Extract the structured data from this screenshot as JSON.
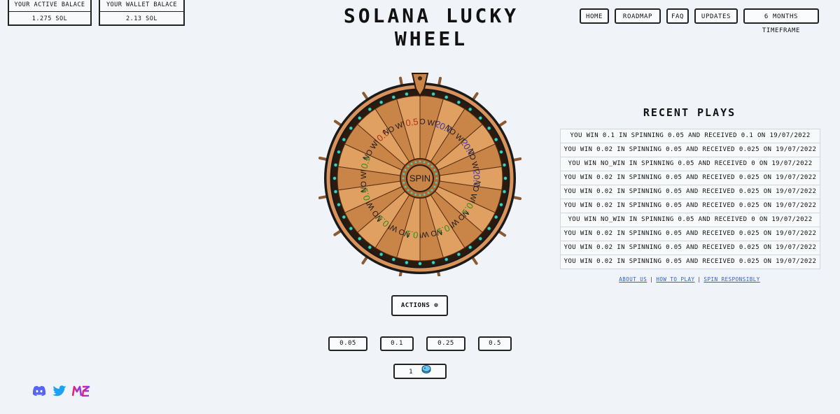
{
  "balances": {
    "active_label": "YOUR ACTIVE BALACE",
    "active_value": "1.275 SOL",
    "wallet_label": "YOUR WALLET BALACE",
    "wallet_value": "2.13 SOL"
  },
  "title": "SOLANA LUCKY WHEEL",
  "nav": [
    "HOME",
    "ROADMAP",
    "FAQ",
    "UPDATES",
    "6 MONTHS TIMEFRAME"
  ],
  "wheel": {
    "center_label": "SPIN",
    "segments": [
      "NO WIN",
      "20.0",
      "NO WIN",
      "20.0",
      "NO WIN",
      "20.0",
      "NO WIN",
      "0.1",
      "NO WIN",
      "0.1",
      "NO WIN",
      "0.1",
      "NO WIN",
      "0.1",
      "NO WIN",
      "0.1",
      "NO WIN",
      "0.1",
      "NO WIN",
      "0.5",
      "NO WIN",
      "0.5"
    ],
    "colors": {
      "wood_light": "#e0a062",
      "wood_dark": "#8a4e22",
      "rim": "#1a1a1a",
      "gem": "#3fd0c0"
    }
  },
  "recent": {
    "title": "RECENT PLAYS",
    "rows": [
      "YOU WIN 0.1 IN SPINNING 0.05 AND RECEIVED 0.1 ON 19/07/2022",
      "YOU WIN 0.02 IN SPINNING 0.05 AND RECEIVED 0.025 ON 19/07/2022",
      "YOU WIN NO_WIN IN SPINNING 0.05 AND RECEIVED 0 ON 19/07/2022",
      "YOU WIN 0.02 IN SPINNING 0.05 AND RECEIVED 0.025 ON 19/07/2022",
      "YOU WIN 0.02 IN SPINNING 0.05 AND RECEIVED 0.025 ON 19/07/2022",
      "YOU WIN 0.02 IN SPINNING 0.05 AND RECEIVED 0.025 ON 19/07/2022",
      "YOU WIN NO_WIN IN SPINNING 0.05 AND RECEIVED 0 ON 19/07/2022",
      "YOU WIN 0.02 IN SPINNING 0.05 AND RECEIVED 0.025 ON 19/07/2022",
      "YOU WIN 0.02 IN SPINNING 0.05 AND RECEIVED 0.025 ON 19/07/2022",
      "YOU WIN 0.02 IN SPINNING 0.05 AND RECEIVED 0.025 ON 19/07/2022"
    ]
  },
  "links": {
    "about": "ABOUT US",
    "how": "HOW TO PLAY",
    "responsibly": "SPIN RESPONSIBLY",
    "sep": "|"
  },
  "actions": {
    "label": "ACTIONS ⊕"
  },
  "bets": [
    "0.05",
    "0.1",
    "0.25",
    "0.5"
  ],
  "quantity": {
    "value": "1",
    "icon": "coin-icon"
  },
  "social": {
    "discord_color": "#5865f2",
    "twitter_color": "#1da1f2",
    "magiceden_color": "#e42575"
  }
}
